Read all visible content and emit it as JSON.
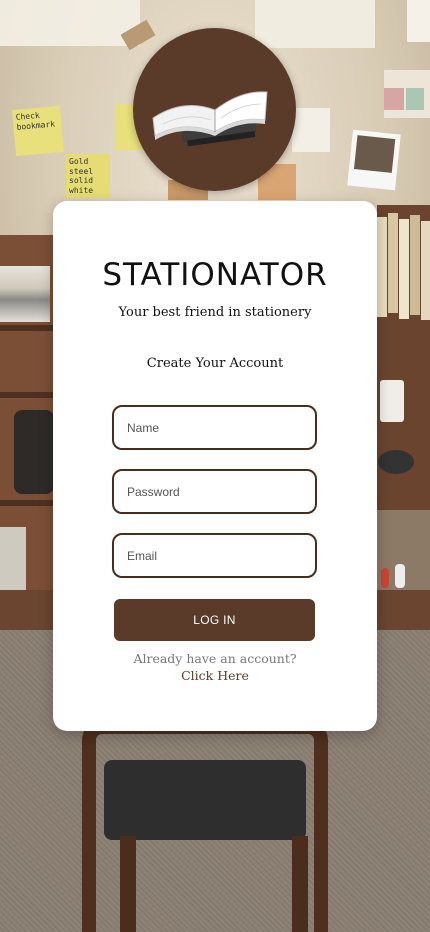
{
  "app": {
    "title": "STATIONATOR",
    "tagline": "Your best friend in stationery",
    "form_heading": "Create Your Account"
  },
  "form": {
    "name": {
      "placeholder": "Name",
      "value": ""
    },
    "password": {
      "placeholder": "Password",
      "value": ""
    },
    "email": {
      "placeholder": "Email",
      "value": ""
    },
    "submit_label": "LOG IN"
  },
  "footer": {
    "prompt": "Already have an account?",
    "link_label": "Click Here"
  },
  "background_notes": {
    "note1": "Check bookmark",
    "note2": "Gold steel solid white"
  },
  "colors": {
    "brand_brown": "#5a3a28",
    "card_bg": "#ffffff",
    "field_border": "#4a2c1c"
  },
  "icons": {
    "logo": "open-book-icon"
  }
}
